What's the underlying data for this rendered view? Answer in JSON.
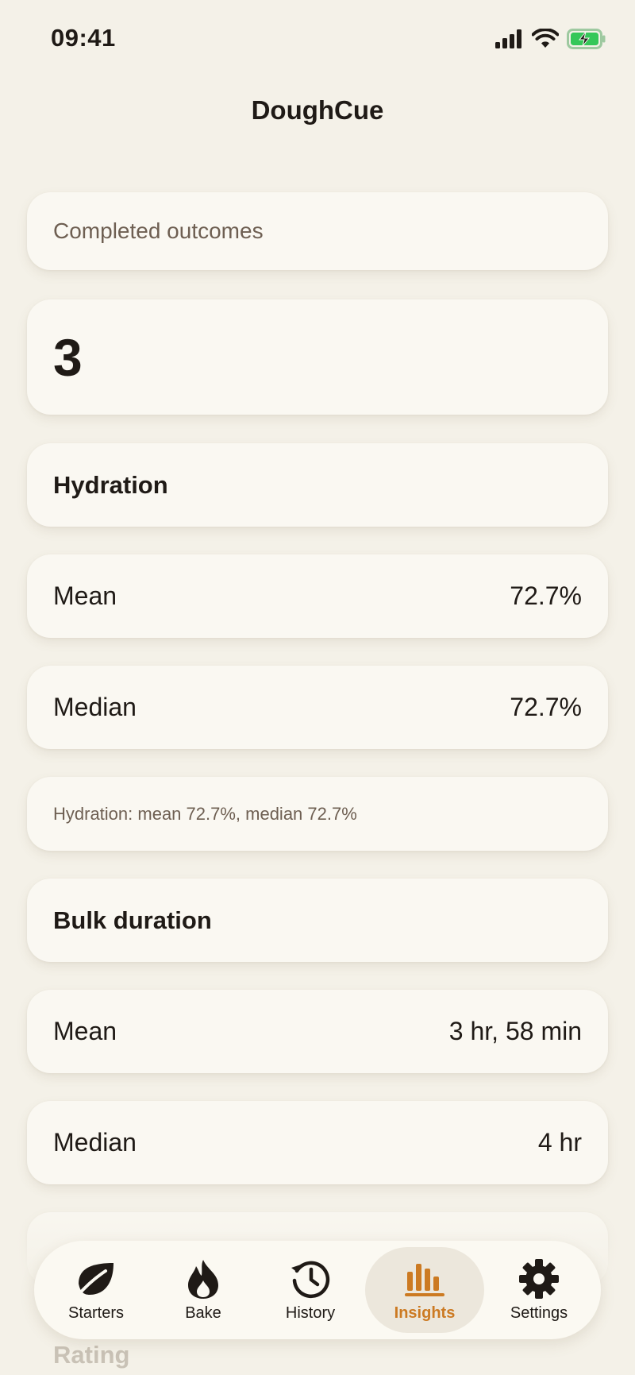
{
  "status_bar": {
    "time": "09:41"
  },
  "nav": {
    "title": "DoughCue"
  },
  "summary": {
    "caption": "Completed outcomes",
    "count": "3"
  },
  "hydration": {
    "title": "Hydration",
    "mean_label": "Mean",
    "mean_value": "72.7%",
    "median_label": "Median",
    "median_value": "72.7%",
    "summary": "Hydration: mean 72.7%, median 72.7%"
  },
  "bulk": {
    "title": "Bulk duration",
    "mean_label": "Mean",
    "mean_value": "3 hr, 58 min",
    "median_label": "Median",
    "median_value": "4 hr"
  },
  "rating": {
    "title": "Rating"
  },
  "tabs": [
    {
      "label": "Starters",
      "icon": "leaf-icon"
    },
    {
      "label": "Bake",
      "icon": "flame-icon"
    },
    {
      "label": "History",
      "icon": "history-clock-icon"
    },
    {
      "label": "Insights",
      "icon": "bar-chart-icon",
      "active": true
    },
    {
      "label": "Settings",
      "icon": "gear-icon"
    }
  ],
  "colors": {
    "background": "#f4f1e8",
    "card": "#faf8f2",
    "accent": "#cc7a22",
    "battery": "#35c759"
  }
}
